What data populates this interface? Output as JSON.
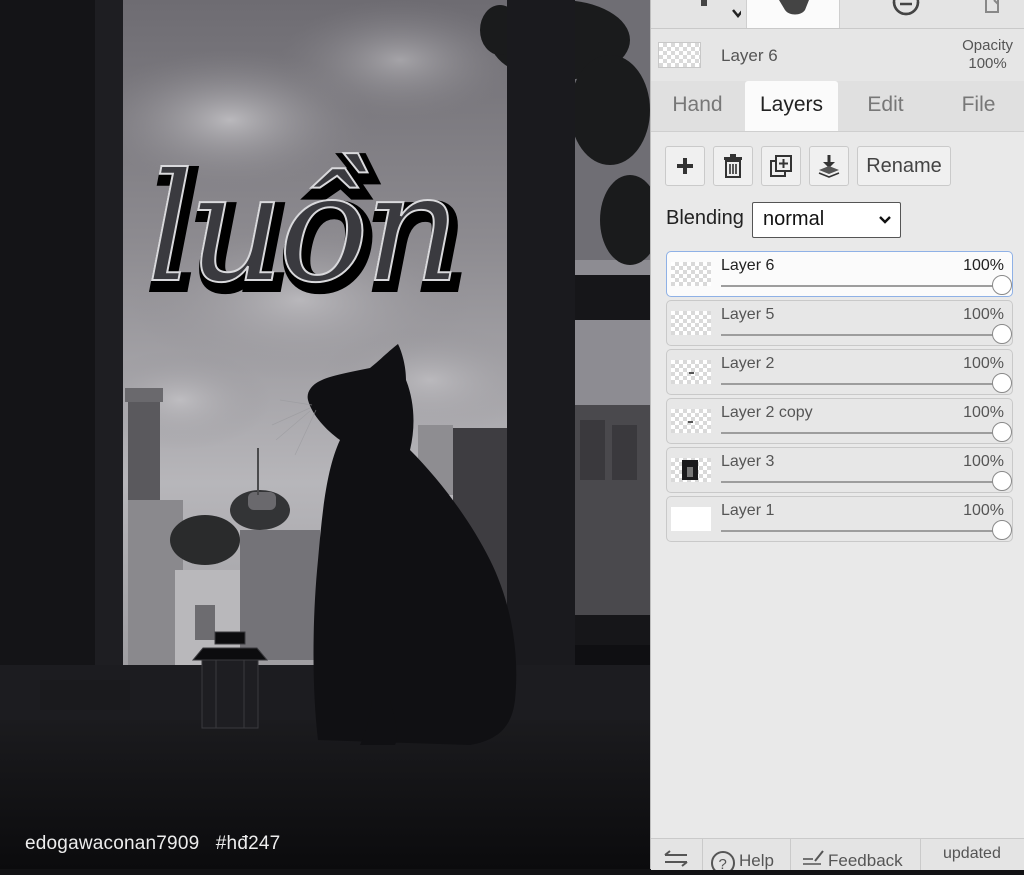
{
  "canvas": {
    "title_text": "luồn",
    "watermark": "edogawaconan7909   #hđ247"
  },
  "top_toolbar": {
    "icons": [
      "text-tool-icon",
      "hand-tool-icon",
      "minus-circle-icon",
      "document-icon"
    ]
  },
  "active_layer": {
    "name": "Layer 6",
    "opacity_label": "Opacity",
    "opacity_value": "100%"
  },
  "tabs": [
    {
      "label": "Hand",
      "active": false
    },
    {
      "label": "Layers",
      "active": true
    },
    {
      "label": "Edit",
      "active": false
    },
    {
      "label": "File",
      "active": false
    }
  ],
  "layer_toolbar": {
    "icons": [
      "add-layer-icon",
      "delete-layer-icon",
      "duplicate-layer-icon",
      "merge-down-icon"
    ],
    "rename_label": "Rename"
  },
  "blending": {
    "label": "Blending",
    "value": "normal"
  },
  "layers": [
    {
      "name": "Layer 6",
      "opacity": "100%",
      "selected": true,
      "opacity_fraction": 1.0
    },
    {
      "name": "Layer 5",
      "opacity": "100%",
      "selected": false,
      "opacity_fraction": 1.0
    },
    {
      "name": "Layer 2",
      "opacity": "100%",
      "selected": false,
      "opacity_fraction": 1.0
    },
    {
      "name": "Layer 2 copy",
      "opacity": "100%",
      "selected": false,
      "opacity_fraction": 1.0
    },
    {
      "name": "Layer 3",
      "opacity": "100%",
      "selected": false,
      "opacity_fraction": 1.0
    },
    {
      "name": "Layer 1",
      "opacity": "100%",
      "selected": false,
      "opacity_fraction": 1.0
    }
  ],
  "bottom_bar": {
    "help_label": "Help",
    "feedback_label": "Feedback",
    "updated_label": "updated"
  },
  "colors": {
    "panel_bg": "#e9e9e9",
    "selected_border": "#8fb1e6"
  }
}
